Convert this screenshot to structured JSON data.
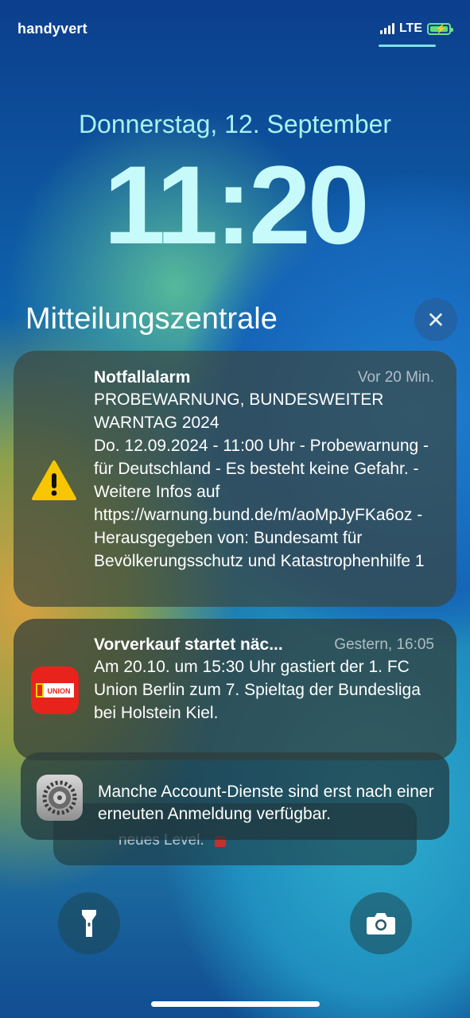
{
  "status_bar": {
    "carrier": "handyvert",
    "network": "LTE",
    "battery_state": "charging",
    "signal_bars": 4
  },
  "lock_screen": {
    "date": "Donnerstag, 12. September",
    "time": "11:20"
  },
  "notification_center": {
    "title": "Mitteilungszentrale",
    "close_icon": "close-icon"
  },
  "notifications": [
    {
      "icon": "warning-triangle-icon",
      "app": "Notfallalarm",
      "time": "Vor 20 Min.",
      "body": "PROBEWARNUNG, BUNDESWEITER WARNTAG 2024\nDo. 12.09.2024 - 11:00 Uhr - Probewarnung - für Deutschland - Es besteht keine Gefahr. - Weitere Infos auf https://warnung.bund.de/m/aoMpJyFKa6oz - Herausgegeben von: Bundesamt für Bevölkerungsschutz und Katastrophenhilfe 1"
    },
    {
      "icon": "union-berlin-icon",
      "icon_text": "UNION",
      "app": "Vorverkauf startet näc...",
      "time": "Gestern, 16:05",
      "body": "Am 20.10. um 15:30 Uhr gastiert der 1. FC Union Berlin zum 7. Spieltag der Bundesliga bei Holstein Kiel."
    },
    {
      "icon": "settings-gear-icon",
      "body": "Manche Account-Dienste sind erst nach einer erneuten Anmeldung verfügbar."
    },
    {
      "body": "neues Level."
    }
  ],
  "bottom_controls": {
    "left": "flashlight-icon",
    "right": "camera-icon"
  },
  "colors": {
    "date_text": "#a6f2f4",
    "time_text": "#c7fbfb",
    "warning": "#f7c600",
    "union_red": "#e8231c",
    "battery": "#5dde7d"
  }
}
